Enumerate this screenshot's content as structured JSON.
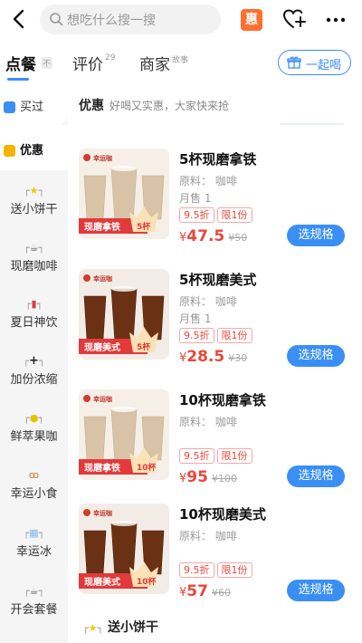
{
  "header": {
    "search_placeholder": "想吃什么搜一搜",
    "hui_label": "惠"
  },
  "tabs": [
    {
      "label": "点餐",
      "sub": "不"
    },
    {
      "label": "评价",
      "sub": "29"
    },
    {
      "label": "商家",
      "sub": "故事"
    }
  ],
  "together_label": "一起喝",
  "sidebar": [
    {
      "label": "买过",
      "icon": "clipboard-icon"
    },
    {
      "label": "优惠",
      "icon": "coupon-icon"
    },
    {
      "label": "送小饼干",
      "icon": "star-icon"
    },
    {
      "label": "现磨咖啡",
      "icon": "coffee-icon"
    },
    {
      "label": "夏日神饮",
      "icon": "drink-icon"
    },
    {
      "label": "加份浓缩",
      "icon": "plus-icon"
    },
    {
      "label": "鲜萃果咖",
      "icon": "lemon-icon"
    },
    {
      "label": "幸运小食",
      "icon": "pretzel-icon"
    },
    {
      "label": "幸运冰",
      "icon": "ice-icon"
    },
    {
      "label": "开会套餐",
      "icon": "coffee-icon"
    }
  ],
  "section": {
    "title": "优惠",
    "subtitle": "好喝又实惠，大家快来抢"
  },
  "products": [
    {
      "name": "5杯现磨拿铁",
      "material": "原料：  咖啡",
      "sales": "月售 1",
      "discount": "9.5折",
      "limit": "限1份",
      "price": "47.5",
      "old_price": "¥50",
      "label": "现磨拿铁",
      "cups": "5杯",
      "kind": "latte",
      "brand": "幸运咖"
    },
    {
      "name": "5杯现磨美式",
      "material": "原料：  咖啡",
      "sales": "月售 1",
      "discount": "9.5折",
      "limit": "限1份",
      "price": "28.5",
      "old_price": "¥30",
      "label": "现磨美式",
      "cups": "5杯",
      "kind": "americano",
      "brand": "幸运咖"
    },
    {
      "name": "10杯现磨拿铁",
      "material": "原料：  咖啡",
      "sales": "",
      "discount": "9.5折",
      "limit": "限1份",
      "price": "95",
      "old_price": "¥100",
      "label": "现磨拿铁",
      "cups": "10杯",
      "kind": "latte",
      "brand": "幸运咖"
    },
    {
      "name": "10杯现磨美式",
      "material": "原料：  咖啡",
      "sales": "",
      "discount": "9.5折",
      "limit": "限1份",
      "price": "57",
      "old_price": "¥60",
      "label": "现磨美式",
      "cups": "10杯",
      "kind": "americano",
      "brand": "幸运咖"
    }
  ],
  "spec_label": "选规格",
  "yen": "¥",
  "next_section": "送小饼干",
  "colors": {
    "accent": "#3a8ff5",
    "price": "#e8473c",
    "badge": "#e23a3a"
  }
}
